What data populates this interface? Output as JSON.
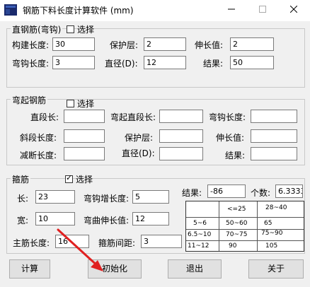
{
  "window": {
    "title": "钢筋下料长度计算软件 (mm)",
    "minimize_icon": "minimize-icon",
    "maximize_icon": "maximize-icon",
    "close_icon": "close-icon"
  },
  "straight_bar": {
    "group_title": "直钢筋(弯钩)",
    "select_label": "选择",
    "select_checked": false,
    "fields": {
      "member_length": {
        "label": "构建长度:",
        "value": "30"
      },
      "cover": {
        "label": "保护层:",
        "value": "2"
      },
      "extension": {
        "label": "伸长值:",
        "value": "2"
      },
      "hook_length": {
        "label": "弯钩长度:",
        "value": "3"
      },
      "diameter": {
        "label": "直径(D):",
        "value": "12"
      },
      "result": {
        "label": "结果:",
        "value": "50"
      }
    }
  },
  "bent_bar": {
    "group_title": "弯起钢筋",
    "select_label": "选择",
    "select_checked": false,
    "labels": {
      "straight_len": "直段长:",
      "bend_straight_len": "弯起直段长:",
      "hook_len": "弯钩长度:",
      "diag_len": "斜段长度:",
      "cover": "保护层:",
      "extension": "伸长值:",
      "reduce_len": "减断长度:",
      "diameter": "直径(D):",
      "result": "结果:"
    }
  },
  "stirrup": {
    "group_title": "箍筋",
    "select_label": "选择",
    "select_checked": true,
    "fields": {
      "length": {
        "label": "长:",
        "value": "23"
      },
      "hook_add": {
        "label": "弯钩增长度:",
        "value": "5"
      },
      "width": {
        "label": "宽:",
        "value": "10"
      },
      "bend_ext": {
        "label": "弯曲伸长值:",
        "value": "12"
      },
      "main_len": {
        "label": "主筋长度:",
        "value": "16"
      },
      "spacing": {
        "label": "箍筋间距:",
        "value": "3"
      },
      "result": {
        "label": "结果:",
        "value": "-86"
      },
      "count": {
        "label": "个数:",
        "value": "6.3333"
      }
    },
    "table": [
      [
        "",
        "<=25",
        "28~40"
      ],
      [
        "5~6",
        "50~60",
        "65"
      ],
      [
        "6.5~10",
        "70~75",
        "75~90"
      ],
      [
        "11~12",
        "90",
        "105"
      ]
    ]
  },
  "buttons": {
    "calc": "计算",
    "init": "初始化",
    "exit": "退出",
    "about": "关于"
  },
  "colors": {
    "window_bg": "#f0f0f0",
    "annotation_arrow": "#e02020"
  }
}
